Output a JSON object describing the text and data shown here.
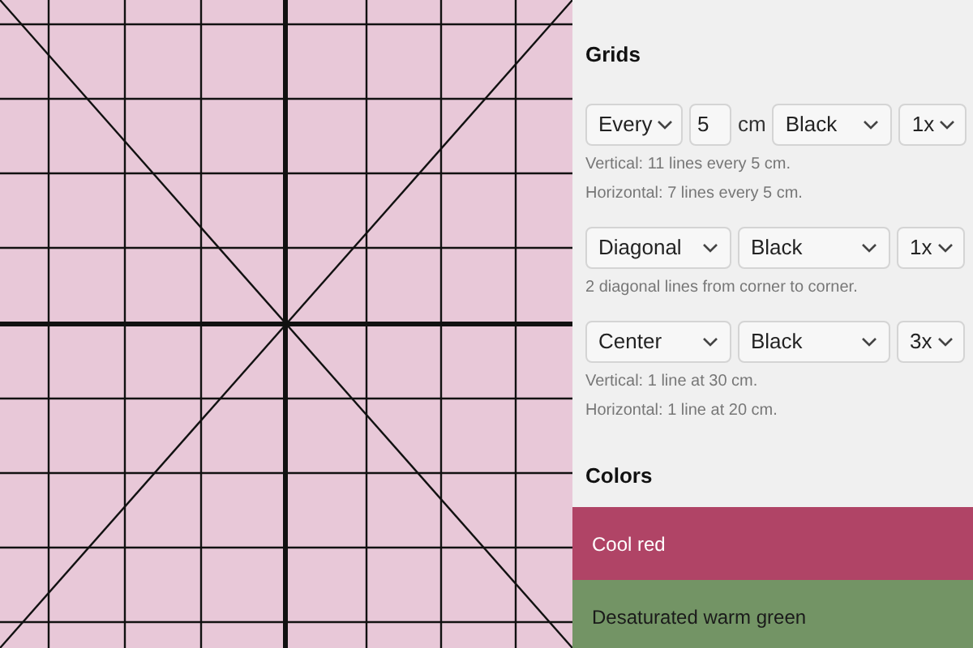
{
  "grids_heading": "Grids",
  "grids": [
    {
      "mode": "Every",
      "spacing": "5",
      "unit": "cm",
      "line_color": "Black",
      "width": "1x",
      "notes": [
        "Vertical: 11 lines every 5 cm.",
        "Horizontal: 7 lines every 5 cm."
      ]
    },
    {
      "mode": "Diagonal",
      "line_color": "Black",
      "width": "1x",
      "notes": [
        "2 diagonal lines from corner to corner."
      ]
    },
    {
      "mode": "Center",
      "line_color": "Black",
      "width": "3x",
      "notes": [
        "Vertical: 1 line at 30 cm.",
        "Horizontal: 1 line at 20 cm."
      ]
    }
  ],
  "colors_heading": "Colors",
  "colors": [
    {
      "label": "Cool red",
      "color": "#b04466"
    },
    {
      "label": "Desaturated warm green",
      "color": "#739465"
    }
  ]
}
